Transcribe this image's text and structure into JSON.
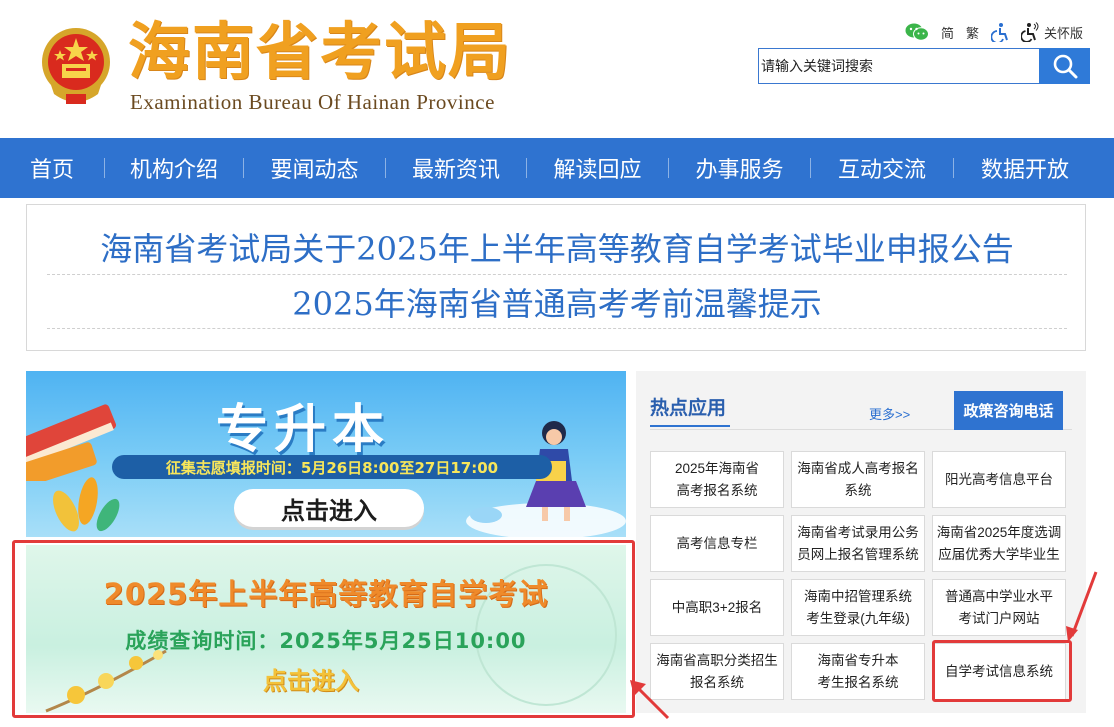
{
  "header": {
    "title_cn": "海南省考试局",
    "title_en": "Examination Bureau Of Hainan Province",
    "tools": {
      "simplified": "简",
      "traditional": "繁",
      "care_mode": "关怀版"
    },
    "search": {
      "placeholder": "请输入关键词搜索"
    }
  },
  "nav": {
    "items": [
      "首页",
      "机构介绍",
      "要闻动态",
      "最新资讯",
      "解读回应",
      "办事服务",
      "互动交流",
      "数据开放"
    ]
  },
  "notices": [
    "海南省考试局关于2025年上半年高等教育自学考试毕业申报公告",
    "2025年海南省普通高考考前温馨提示"
  ],
  "banner1": {
    "title": "专升本",
    "subtitle": "征集志愿填报时间：5月26日8:00至27日17:00",
    "button": "点击进入"
  },
  "banner2": {
    "title": "2025年上半年高等教育自学考试",
    "subtitle": "成绩查询时间：2025年5月25日10:00",
    "button": "点击进入"
  },
  "hot_apps": {
    "title": "热点应用",
    "more": "更多>>",
    "phone": "政策咨询电话",
    "apps": [
      {
        "line1": "2025年海南省",
        "line2": "高考报名系统"
      },
      {
        "line1": "海南省成人高考报名",
        "line2": "系统"
      },
      {
        "line1": "阳光高考信息平台",
        "line2": ""
      },
      {
        "line1": "高考信息专栏",
        "line2": ""
      },
      {
        "line1": "海南省考试录用公务",
        "line2": "员网上报名管理系统"
      },
      {
        "line1": "海南省2025年度选调",
        "line2": "应届优秀大学毕业生"
      },
      {
        "line1": "中高职3+2报名",
        "line2": ""
      },
      {
        "line1": "海南中招管理系统",
        "line2": "考生登录(九年级)"
      },
      {
        "line1": "普通高中学业水平",
        "line2": "考试门户网站"
      },
      {
        "line1": "海南省高职分类招生",
        "line2": "报名系统"
      },
      {
        "line1": "海南省专升本",
        "line2": "考生报名系统"
      },
      {
        "line1": "自学考试信息系统",
        "line2": ""
      }
    ]
  },
  "colors": {
    "nav_blue": "#2f73d0",
    "title_orange": "#f0a020",
    "notice_blue": "#2d6ec6",
    "highlight_red": "#e23a3a"
  }
}
